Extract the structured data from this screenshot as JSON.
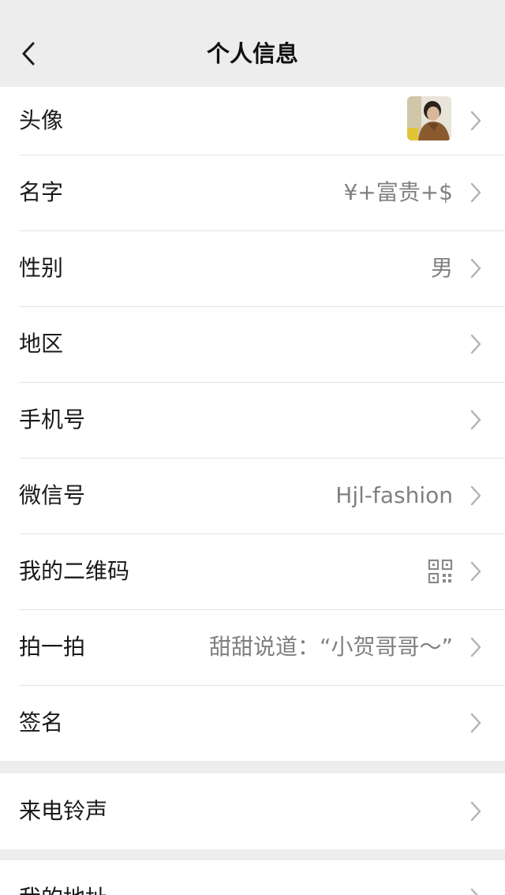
{
  "nav": {
    "title": "个人信息"
  },
  "profile": {
    "avatar_label": "头像",
    "name_label": "名字",
    "name_value": "¥+富贵+$",
    "gender_label": "性别",
    "gender_value": "男",
    "region_label": "地区",
    "phone_label": "手机号",
    "wechat_id_label": "微信号",
    "wechat_id_value": "Hjl-fashion",
    "qrcode_label": "我的二维码",
    "pat_label": "拍一拍",
    "pat_value": "甜甜说道：“小贺哥哥～”",
    "signature_label": "签名"
  },
  "ringtone": {
    "label": "来电铃声"
  },
  "address": {
    "label": "我的地址"
  },
  "icons": {
    "back": "chevron-left-icon",
    "row_arrow": "chevron-right-icon",
    "qrcode": "qrcode-icon"
  },
  "colors": {
    "background": "#ededed",
    "card": "#ffffff",
    "label": "#191919",
    "value": "#808080",
    "divider": "#e5e5e5"
  }
}
